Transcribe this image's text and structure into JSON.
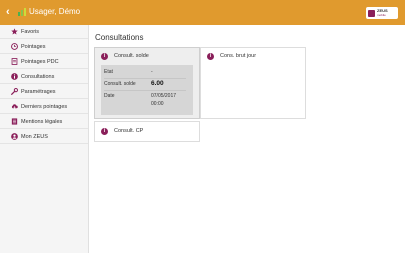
{
  "header": {
    "title": "Usager, Démo",
    "brand_name": "ZEUS",
    "brand_sub": "mobile",
    "color": "#e09a2e"
  },
  "sidebar": {
    "items": [
      {
        "label": "Favoris",
        "icon": "star-icon"
      },
      {
        "label": "Pointages",
        "icon": "clock-icon"
      },
      {
        "label": "Pointages PDC",
        "icon": "document-icon"
      },
      {
        "label": "Consultations",
        "icon": "info-icon"
      },
      {
        "label": "Paramétrages",
        "icon": "wrench-icon"
      },
      {
        "label": "Derniers pointages",
        "icon": "cloud-download-icon"
      },
      {
        "label": "Mentions légales",
        "icon": "page-icon"
      },
      {
        "label": "Mon ZEUS",
        "icon": "user-icon"
      }
    ]
  },
  "main": {
    "title": "Consultations",
    "tiles": [
      {
        "title": "Consult. solde",
        "details": {
          "etat_label": "Etat",
          "etat_value": "-",
          "solde_label": "Consult. solde",
          "solde_value": "6.00",
          "date_label": "Date",
          "date_value_1": "07/05/2017",
          "date_value_2": "00:00"
        }
      },
      {
        "title": "Cons. brut jour"
      },
      {
        "title": "Consult. CP"
      }
    ]
  },
  "colors": {
    "accent": "#e09a2e",
    "icon": "#8a1f5a"
  }
}
